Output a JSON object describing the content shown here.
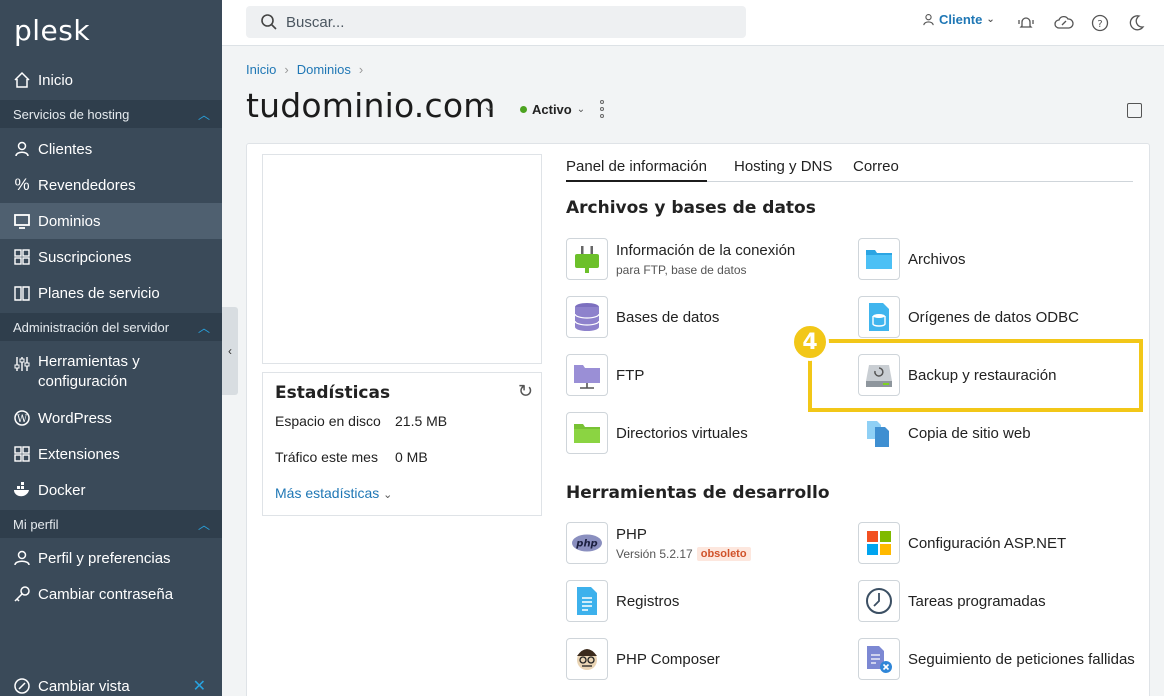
{
  "app": {
    "logo": "plesk"
  },
  "sidebar": {
    "items": [
      {
        "label": "Inicio",
        "icon": "home-icon"
      },
      {
        "label": "Clientes",
        "icon": "user-icon"
      },
      {
        "label": "Revendedores",
        "icon": "percent-icon"
      },
      {
        "label": "Dominios",
        "icon": "monitor-icon"
      },
      {
        "label": "Suscripciones",
        "icon": "grid-icon"
      },
      {
        "label": "Planes de servicio",
        "icon": "book-icon"
      },
      {
        "label": "Herramientas y configuración",
        "icon": "sliders-icon"
      },
      {
        "label": "WordPress",
        "icon": "wordpress-icon"
      },
      {
        "label": "Extensiones",
        "icon": "extensions-icon"
      },
      {
        "label": "Docker",
        "icon": "docker-icon"
      },
      {
        "label": "Perfil y preferencias",
        "icon": "profile-icon"
      },
      {
        "label": "Cambiar contraseña",
        "icon": "key-icon"
      },
      {
        "label": "Cambiar vista",
        "icon": "switch-view-icon"
      }
    ],
    "sections": [
      "Servicios de hosting",
      "Administración del servidor",
      "Mi perfil"
    ]
  },
  "topbar": {
    "search_placeholder": "Buscar...",
    "user": "Cliente"
  },
  "breadcrumb": [
    "Inicio",
    "Dominios"
  ],
  "page": {
    "title": "tudominio.com",
    "status": "Activo"
  },
  "stats": {
    "title": "Estadísticas",
    "disk_label": "Espacio en disco",
    "disk_value": "21.5 MB",
    "traffic_label": "Tráfico este mes",
    "traffic_value": "0 MB",
    "more": "Más estadísticas"
  },
  "tabs": [
    "Panel de información",
    "Hosting y DNS",
    "Correo"
  ],
  "groups": {
    "files": "Archivos y bases de datos",
    "dev": "Herramientas de desarrollo"
  },
  "tools": {
    "conn": {
      "label": "Información de la conexión",
      "sub": "para FTP, base de datos"
    },
    "files": "Archivos",
    "db": "Bases de datos",
    "odbc": "Orígenes de datos ODBC",
    "ftp": "FTP",
    "backup": "Backup y restauración",
    "vdirs": "Directorios virtuales",
    "copy": "Copia de sitio web",
    "php": {
      "label": "PHP",
      "version": "Versión 5.2.17",
      "badge": "obsoleto"
    },
    "asp": "Configuración ASP.NET",
    "logs": "Registros",
    "cron": "Tareas programadas",
    "composer": "PHP Composer",
    "failed": "Seguimiento de peticiones fallidas"
  },
  "annotation": {
    "step": "4"
  },
  "colors": {
    "sidebar": "#3a4a59",
    "accent": "#1f77b5",
    "highlight": "#f2c718"
  }
}
